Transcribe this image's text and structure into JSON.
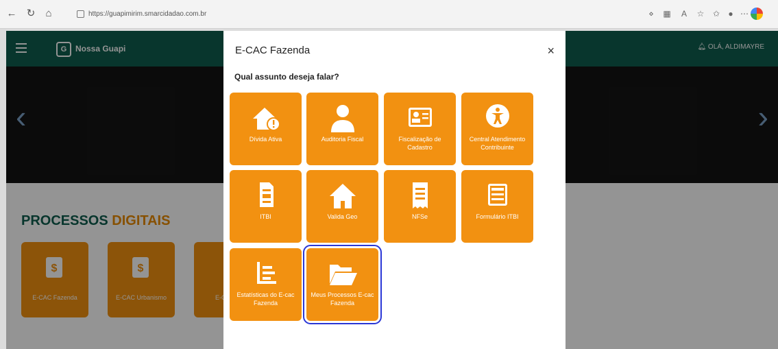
{
  "browser": {
    "url": "https://guapimirim.smarcidadao.com.br",
    "back_icon": "arrow-left-icon",
    "refresh_icon": "refresh-icon",
    "home_icon": "home-icon"
  },
  "site": {
    "logo_text": "Nossa Guapi",
    "logo_mark": "G",
    "greeting": "OLÁ, ALDIMAYRE",
    "section_title_part1": "PROCESSOS",
    "section_title_part2": "DIGITAIS",
    "cards": [
      {
        "label": "E-CAC Fazenda"
      },
      {
        "label": "E-CAC Urbanismo"
      },
      {
        "label": "E-CAC A"
      }
    ],
    "colors": {
      "header": "#0e5d4e",
      "accent": "#f29111"
    }
  },
  "modal": {
    "title": "E-CAC Fazenda",
    "close_symbol": "×",
    "question": "Qual assunto deseja falar?",
    "tiles": [
      {
        "label": "Dívida Ativa",
        "icon": "house-alert-icon"
      },
      {
        "label": "Auditoria Fiscal",
        "icon": "user-icon"
      },
      {
        "label": "Fiscalização de Cadastro",
        "icon": "id-card-icon"
      },
      {
        "label": "Central Atendimento Contribuinte",
        "icon": "accessibility-icon"
      },
      {
        "label": "ITBI",
        "icon": "file-document-icon"
      },
      {
        "label": "Valida Geo",
        "icon": "home-icon"
      },
      {
        "label": "NFSe",
        "icon": "receipt-icon"
      },
      {
        "label": "Formulário ITBI",
        "icon": "form-icon"
      },
      {
        "label": "Estatísticas do E-cac Fazenda",
        "icon": "bar-list-icon"
      },
      {
        "label": "Meus Processos E-cac Fazenda",
        "icon": "folder-open-icon",
        "selected": true
      }
    ]
  }
}
